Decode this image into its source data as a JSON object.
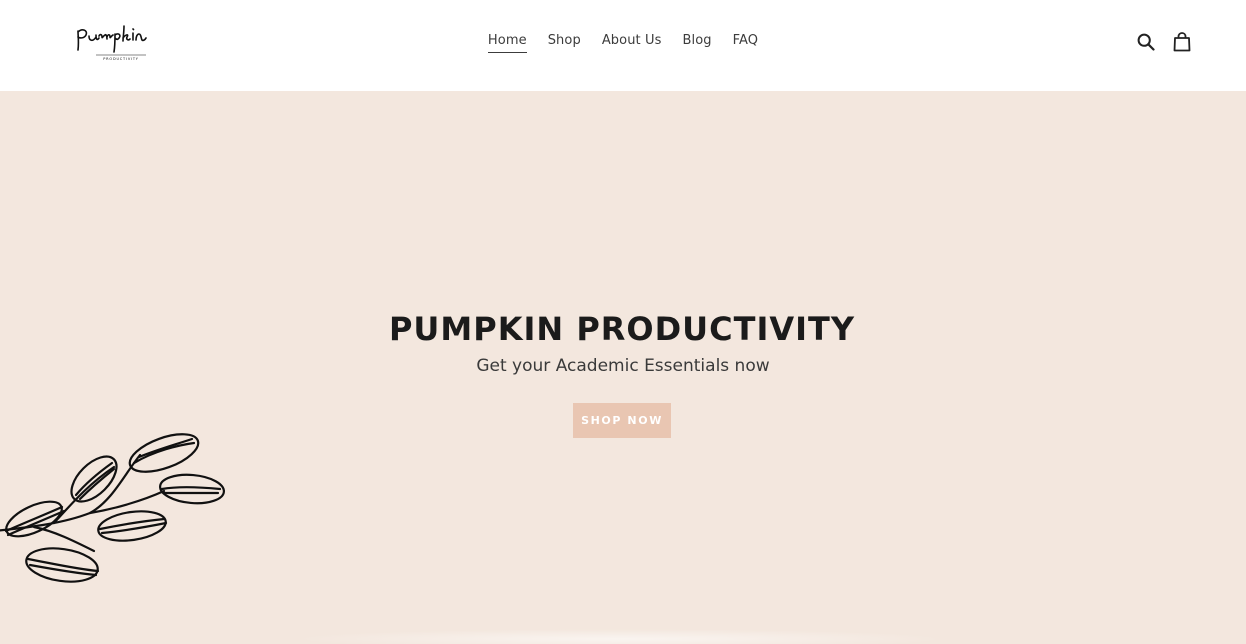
{
  "brand": {
    "logo_text": "pumpkin",
    "logo_subtext": "PRODUCTIVITY"
  },
  "nav": {
    "items": [
      {
        "label": "Home",
        "active": true
      },
      {
        "label": "Shop",
        "active": false
      },
      {
        "label": "About Us",
        "active": false
      },
      {
        "label": "Blog",
        "active": false
      },
      {
        "label": "FAQ",
        "active": false
      }
    ]
  },
  "header_icons": [
    "search-icon",
    "shopping-bag-icon"
  ],
  "hero": {
    "title": "PUMPKIN PRODUCTIVITY",
    "subtitle": "Get your Academic Essentials now",
    "cta_label": "SHOP NOW"
  },
  "colors": {
    "background": "#f3e7de",
    "header_bg": "#ffffff",
    "cta_bg": "#e9c6b2",
    "text_dark": "#1b1b1b"
  }
}
